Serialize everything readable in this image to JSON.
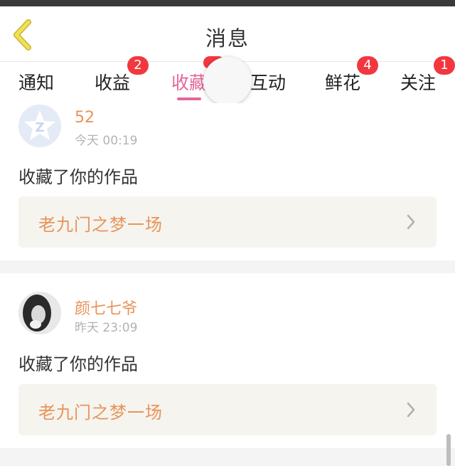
{
  "header": {
    "title": "消息",
    "back_icon": "chevron-left-icon"
  },
  "tabs": [
    {
      "label": "通知",
      "badge": null,
      "active": false
    },
    {
      "label": "收益",
      "badge": "2",
      "active": false
    },
    {
      "label": "收藏",
      "badge": "",
      "active": true
    },
    {
      "label": "互动",
      "badge": null,
      "active": false
    },
    {
      "label": "鲜花",
      "badge": "4",
      "active": false
    },
    {
      "label": "关注",
      "badge": "1",
      "active": false
    }
  ],
  "messages": [
    {
      "username": "52",
      "time": "今天 00:19",
      "action": "收藏了你的作品",
      "work_title": "老九门之梦一场",
      "avatar": "default-star-avatar"
    },
    {
      "username": "颜七七爷",
      "time": "昨天 23:09",
      "action": "收藏了你的作品",
      "work_title": "老九门之梦一场",
      "avatar": "photo-avatar"
    }
  ],
  "colors": {
    "accent": "#e5669a",
    "badge": "#f2373f",
    "username": "#e8945a",
    "work_bg": "#f5f4ef"
  }
}
